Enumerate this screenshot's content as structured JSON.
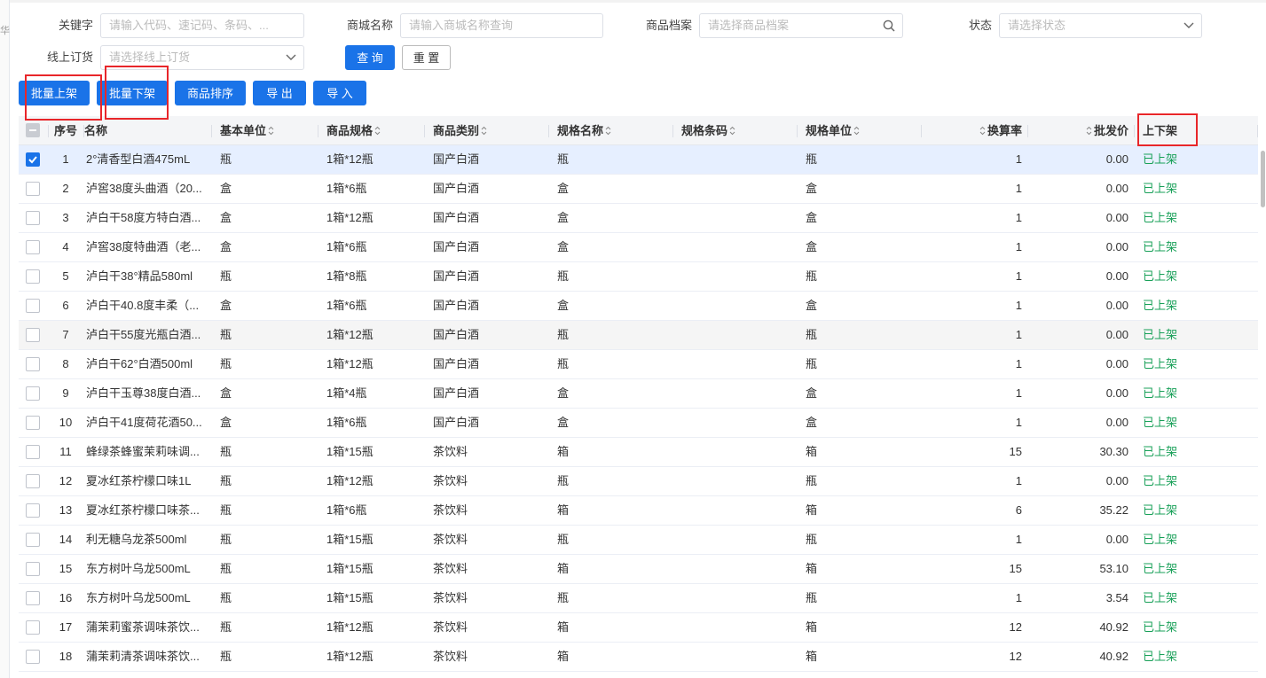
{
  "sidebar_edge_text": "华",
  "filters": {
    "keyword": {
      "label": "关键字",
      "placeholder": "请输入代码、速记码、条码、..."
    },
    "mall_name": {
      "label": "商城名称",
      "placeholder": "请输入商城名称查询"
    },
    "product_file": {
      "label": "商品档案",
      "placeholder": "请选择商品档案"
    },
    "status": {
      "label": "状态",
      "placeholder": "请选择状态"
    },
    "online_order": {
      "label": "线上订货",
      "placeholder": "请选择线上订货"
    },
    "query_label": "查 询",
    "reset_label": "重 置"
  },
  "actions": {
    "batch_on": "批量上架",
    "batch_off": "批量下架",
    "sort": "商品排序",
    "export": "导 出",
    "import": "导 入"
  },
  "columns": {
    "index": "序号",
    "name": "名称",
    "base_unit": "基本单位",
    "spec": "商品规格",
    "category": "商品类别",
    "spec_name": "规格名称",
    "spec_barcode": "规格条码",
    "spec_unit": "规格单位",
    "rate": "换算率",
    "price": "批发价",
    "status": "上下架"
  },
  "colors": {
    "primary": "#1a73e8",
    "highlight": "#e8262a",
    "status_green": "#18a058"
  },
  "rows": [
    {
      "i": "1",
      "name": "2°清香型白酒475mL",
      "unit": "瓶",
      "spec": "1箱*12瓶",
      "cat": "国产白酒",
      "sname": "瓶",
      "sbar": "",
      "sunit": "瓶",
      "rate": "1",
      "price": "0.00",
      "status": "已上架"
    },
    {
      "i": "2",
      "name": "泸窖38度头曲酒（20...",
      "unit": "盒",
      "spec": "1箱*6瓶",
      "cat": "国产白酒",
      "sname": "盒",
      "sbar": "",
      "sunit": "盒",
      "rate": "1",
      "price": "0.00",
      "status": "已上架"
    },
    {
      "i": "3",
      "name": "泸白干58度方特白酒...",
      "unit": "盒",
      "spec": "1箱*12瓶",
      "cat": "国产白酒",
      "sname": "盒",
      "sbar": "",
      "sunit": "盒",
      "rate": "1",
      "price": "0.00",
      "status": "已上架"
    },
    {
      "i": "4",
      "name": "泸窖38度特曲酒（老...",
      "unit": "盒",
      "spec": "1箱*6瓶",
      "cat": "国产白酒",
      "sname": "盒",
      "sbar": "",
      "sunit": "盒",
      "rate": "1",
      "price": "0.00",
      "status": "已上架"
    },
    {
      "i": "5",
      "name": "泸白干38°精品580ml",
      "unit": "瓶",
      "spec": "1箱*8瓶",
      "cat": "国产白酒",
      "sname": "瓶",
      "sbar": "",
      "sunit": "瓶",
      "rate": "1",
      "price": "0.00",
      "status": "已上架"
    },
    {
      "i": "6",
      "name": "泸白干40.8度丰柔（...",
      "unit": "盒",
      "spec": "1箱*6瓶",
      "cat": "国产白酒",
      "sname": "盒",
      "sbar": "",
      "sunit": "盒",
      "rate": "1",
      "price": "0.00",
      "status": "已上架"
    },
    {
      "i": "7",
      "name": "泸白干55度光瓶白酒...",
      "unit": "瓶",
      "spec": "1箱*12瓶",
      "cat": "国产白酒",
      "sname": "瓶",
      "sbar": "",
      "sunit": "瓶",
      "rate": "1",
      "price": "0.00",
      "status": "已上架"
    },
    {
      "i": "8",
      "name": "泸白干62°白酒500ml",
      "unit": "瓶",
      "spec": "1箱*12瓶",
      "cat": "国产白酒",
      "sname": "瓶",
      "sbar": "",
      "sunit": "瓶",
      "rate": "1",
      "price": "0.00",
      "status": "已上架"
    },
    {
      "i": "9",
      "name": "泸白干玉尊38度白酒...",
      "unit": "盒",
      "spec": "1箱*4瓶",
      "cat": "国产白酒",
      "sname": "盒",
      "sbar": "",
      "sunit": "盒",
      "rate": "1",
      "price": "0.00",
      "status": "已上架"
    },
    {
      "i": "10",
      "name": "泸白干41度荷花酒50...",
      "unit": "盒",
      "spec": "1箱*6瓶",
      "cat": "国产白酒",
      "sname": "盒",
      "sbar": "",
      "sunit": "盒",
      "rate": "1",
      "price": "0.00",
      "status": "已上架"
    },
    {
      "i": "11",
      "name": "蜂绿茶蜂蜜茉莉味调...",
      "unit": "瓶",
      "spec": "1箱*15瓶",
      "cat": "茶饮料",
      "sname": "箱",
      "sbar": "",
      "sunit": "箱",
      "rate": "15",
      "price": "30.30",
      "status": "已上架"
    },
    {
      "i": "12",
      "name": "夏冰红茶柠檬口味1L",
      "unit": "瓶",
      "spec": "1箱*12瓶",
      "cat": "茶饮料",
      "sname": "瓶",
      "sbar": "",
      "sunit": "瓶",
      "rate": "1",
      "price": "0.00",
      "status": "已上架"
    },
    {
      "i": "13",
      "name": "夏冰红茶柠檬口味茶...",
      "unit": "瓶",
      "spec": "1箱*6瓶",
      "cat": "茶饮料",
      "sname": "箱",
      "sbar": "",
      "sunit": "箱",
      "rate": "6",
      "price": "35.22",
      "status": "已上架"
    },
    {
      "i": "14",
      "name": "利无糖乌龙茶500ml",
      "unit": "瓶",
      "spec": "1箱*15瓶",
      "cat": "茶饮料",
      "sname": "瓶",
      "sbar": "",
      "sunit": "瓶",
      "rate": "1",
      "price": "0.00",
      "status": "已上架"
    },
    {
      "i": "15",
      "name": "东方树叶乌龙500mL",
      "unit": "瓶",
      "spec": "1箱*15瓶",
      "cat": "茶饮料",
      "sname": "箱",
      "sbar": "",
      "sunit": "箱",
      "rate": "15",
      "price": "53.10",
      "status": "已上架"
    },
    {
      "i": "16",
      "name": "东方树叶乌龙500mL",
      "unit": "瓶",
      "spec": "1箱*15瓶",
      "cat": "茶饮料",
      "sname": "瓶",
      "sbar": "",
      "sunit": "瓶",
      "rate": "1",
      "price": "3.54",
      "status": "已上架"
    },
    {
      "i": "17",
      "name": "蒲茉莉蜜茶调味茶饮...",
      "unit": "瓶",
      "spec": "1箱*12瓶",
      "cat": "茶饮料",
      "sname": "箱",
      "sbar": "",
      "sunit": "箱",
      "rate": "12",
      "price": "40.92",
      "status": "已上架"
    },
    {
      "i": "18",
      "name": "蒲茉莉清茶调味茶饮...",
      "unit": "瓶",
      "spec": "1箱*12瓶",
      "cat": "茶饮料",
      "sname": "箱",
      "sbar": "",
      "sunit": "箱",
      "rate": "12",
      "price": "40.92",
      "status": "已上架"
    }
  ]
}
